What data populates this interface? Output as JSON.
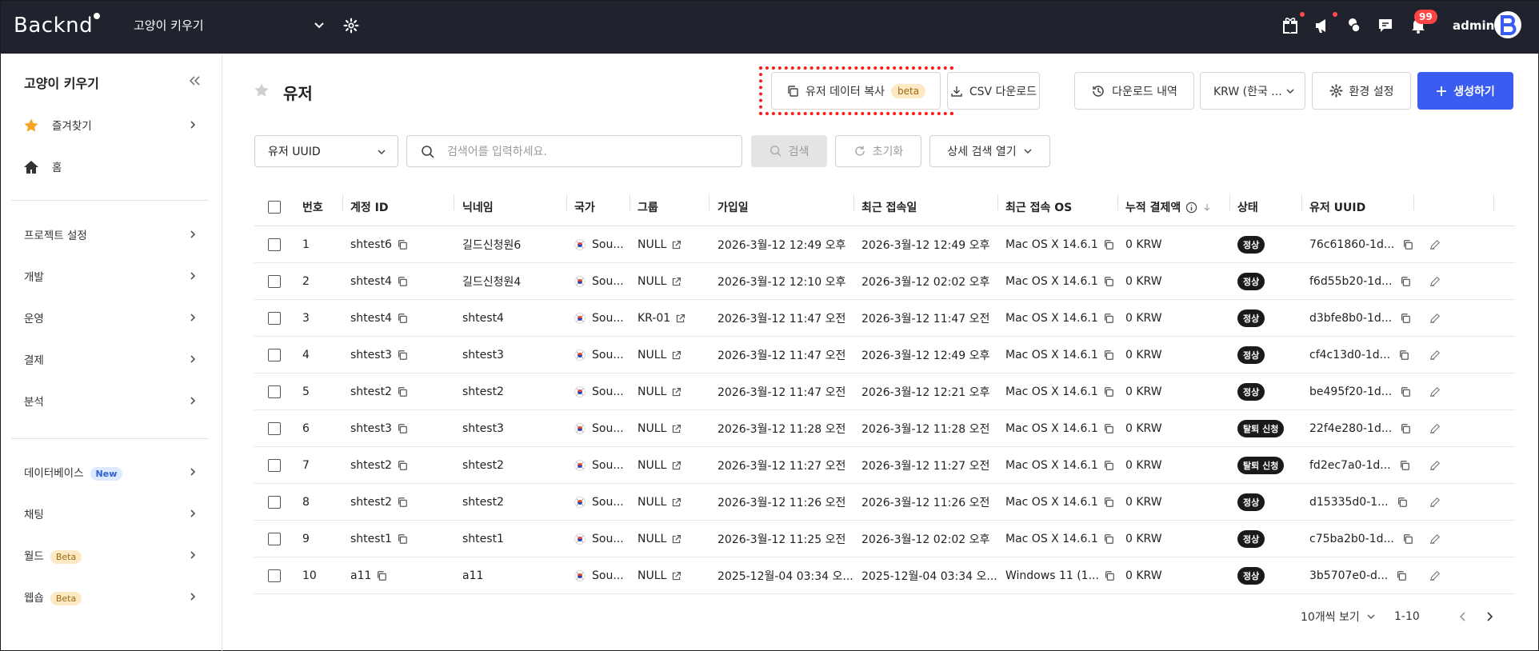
{
  "topbar": {
    "logo": "Backnd",
    "project": "고양이 키우기",
    "notification_count": "99",
    "user": "admin"
  },
  "sidebar": {
    "title": "고양이 키우기",
    "favorites": "즐겨찾기",
    "home": "홈",
    "group1": [
      "프로젝트 설정",
      "개발",
      "운영",
      "결제",
      "분석"
    ],
    "database": "데이터베이스",
    "new_tag": "New",
    "chat": "채팅",
    "world": "월드",
    "webshop": "웹숍",
    "beta_tag": "Beta"
  },
  "page": {
    "title": "유저",
    "copy_button": "유저 데이터 복사",
    "copy_beta": "beta",
    "csv_button": "CSV 다운로드",
    "history_button": "다운로드 내역",
    "currency_select": "KRW (한국 ...",
    "settings_button": "환경 설정",
    "create_button": "생성하기"
  },
  "search": {
    "field_select": "유저 UUID",
    "placeholder": "검색어를 입력하세요.",
    "search_button": "검색",
    "reset_button": "초기화",
    "advanced_button": "상세 검색 열기"
  },
  "table": {
    "headers": [
      "번호",
      "계정 ID",
      "닉네임",
      "국가",
      "그룹",
      "가입일",
      "최근 접속일",
      "최근 접속 OS",
      "누적 결제액",
      "상태",
      "유저 UUID"
    ],
    "rows": [
      {
        "no": "1",
        "id": "shtest6",
        "nick": "길드신청원6",
        "country": "Sou...",
        "group": "NULL",
        "joined": "2026-3월-12 12:49 오후",
        "last": "2026-3월-12 12:49 오후",
        "os": "Mac OS X 14.6.1",
        "paid": "0 KRW",
        "status": "정상",
        "uuid": "76c61860-1d..."
      },
      {
        "no": "2",
        "id": "shtest4",
        "nick": "길드신청원4",
        "country": "Sou...",
        "group": "NULL",
        "joined": "2026-3월-12 12:10 오후",
        "last": "2026-3월-12 02:02 오후",
        "os": "Mac OS X 14.6.1",
        "paid": "0 KRW",
        "status": "정상",
        "uuid": "f6d55b20-1d..."
      },
      {
        "no": "3",
        "id": "shtest4",
        "nick": "shtest4",
        "country": "Sou...",
        "group": "KR-01",
        "joined": "2026-3월-12 11:47 오전",
        "last": "2026-3월-12 11:47 오전",
        "os": "Mac OS X 14.6.1",
        "paid": "0 KRW",
        "status": "정상",
        "uuid": "d3bfe8b0-1d..."
      },
      {
        "no": "4",
        "id": "shtest3",
        "nick": "shtest3",
        "country": "Sou...",
        "group": "NULL",
        "joined": "2026-3월-12 11:47 오전",
        "last": "2026-3월-12 12:49 오후",
        "os": "Mac OS X 14.6.1",
        "paid": "0 KRW",
        "status": "정상",
        "uuid": "cf4c13d0-1d..."
      },
      {
        "no": "5",
        "id": "shtest2",
        "nick": "shtest2",
        "country": "Sou...",
        "group": "NULL",
        "joined": "2026-3월-12 11:47 오전",
        "last": "2026-3월-12 12:21 오후",
        "os": "Mac OS X 14.6.1",
        "paid": "0 KRW",
        "status": "정상",
        "uuid": "be495f20-1d..."
      },
      {
        "no": "6",
        "id": "shtest3",
        "nick": "shtest3",
        "country": "Sou...",
        "group": "NULL",
        "joined": "2026-3월-12 11:28 오전",
        "last": "2026-3월-12 11:28 오전",
        "os": "Mac OS X 14.6.1",
        "paid": "0 KRW",
        "status": "탈퇴 신청",
        "uuid": "22f4e280-1d..."
      },
      {
        "no": "7",
        "id": "shtest2",
        "nick": "shtest2",
        "country": "Sou...",
        "group": "NULL",
        "joined": "2026-3월-12 11:27 오전",
        "last": "2026-3월-12 11:27 오전",
        "os": "Mac OS X 14.6.1",
        "paid": "0 KRW",
        "status": "탈퇴 신청",
        "uuid": "fd2ec7a0-1d..."
      },
      {
        "no": "8",
        "id": "shtest2",
        "nick": "shtest2",
        "country": "Sou...",
        "group": "NULL",
        "joined": "2026-3월-12 11:26 오전",
        "last": "2026-3월-12 11:26 오전",
        "os": "Mac OS X 14.6.1",
        "paid": "0 KRW",
        "status": "정상",
        "uuid": "d15335d0-1..."
      },
      {
        "no": "9",
        "id": "shtest1",
        "nick": "shtest1",
        "country": "Sou...",
        "group": "NULL",
        "joined": "2026-3월-12 11:25 오전",
        "last": "2026-3월-12 02:02 오후",
        "os": "Mac OS X 14.6.1",
        "paid": "0 KRW",
        "status": "정상",
        "uuid": "c75ba2b0-1d..."
      },
      {
        "no": "10",
        "id": "a11",
        "nick": "a11",
        "country": "Sou...",
        "group": "NULL",
        "joined": "2025-12월-04 03:34 오...",
        "last": "2025-12월-04 03:34 오...",
        "os": "Windows 11 (1...",
        "paid": "0 KRW",
        "status": "정상",
        "uuid": "3b5707e0-d..."
      }
    ]
  },
  "pagination": {
    "page_size": "10개씩 보기",
    "range": "1-10"
  }
}
